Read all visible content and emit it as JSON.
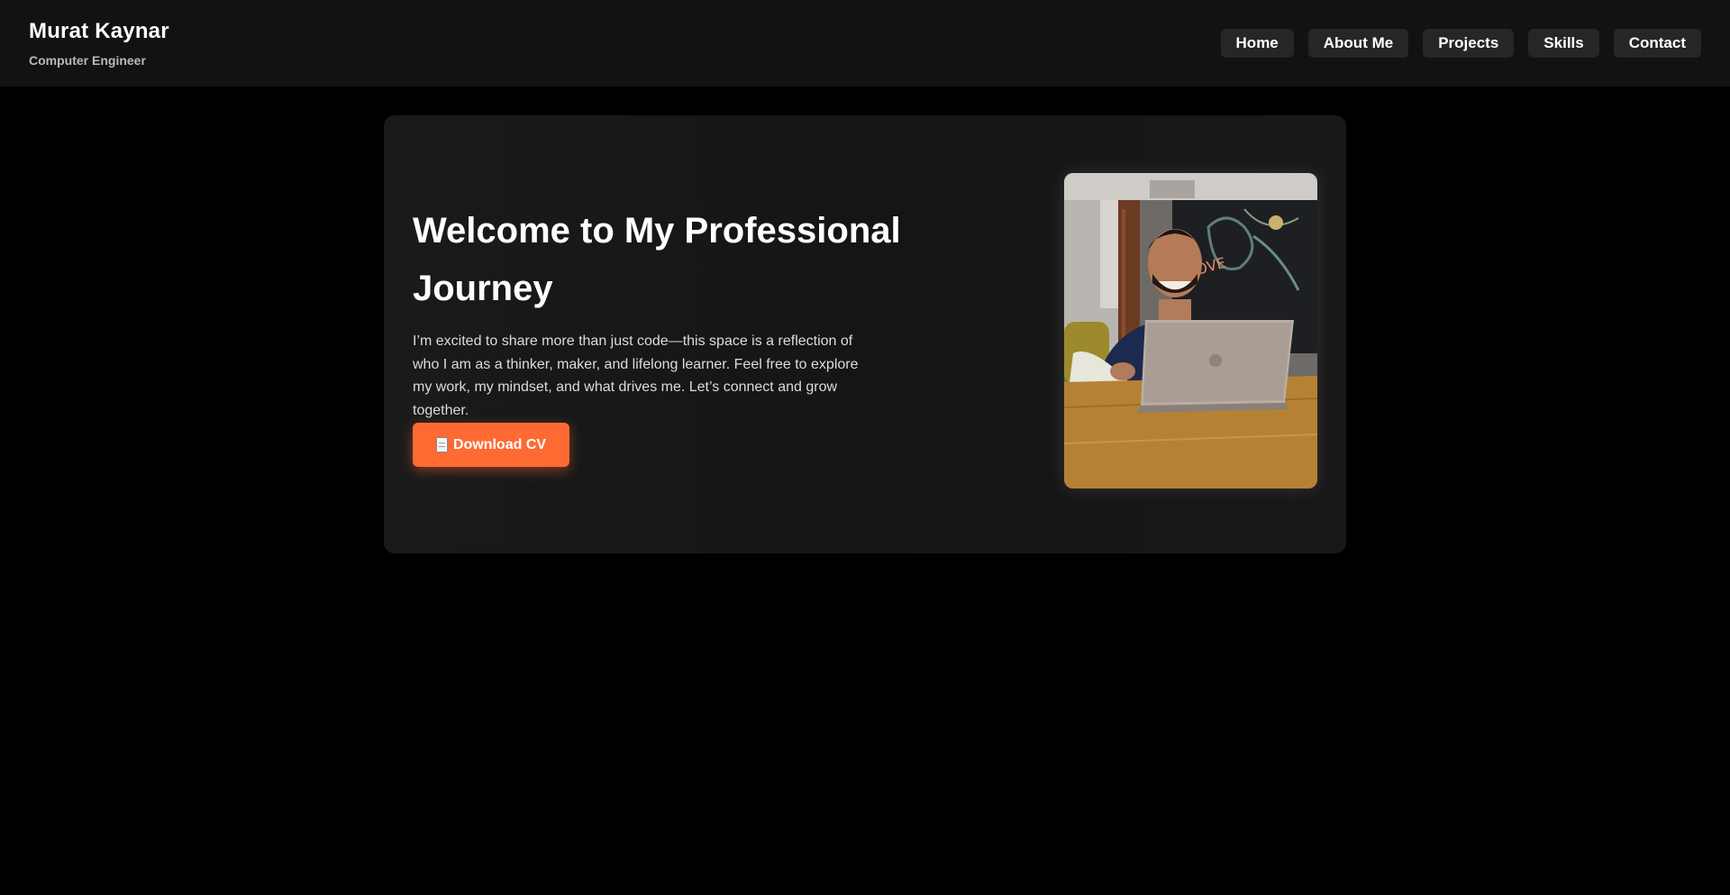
{
  "header": {
    "name": "Murat Kaynar",
    "role": "Computer Engineer",
    "nav": [
      "Home",
      "About Me",
      "Projects",
      "Skills",
      "Contact"
    ]
  },
  "hero": {
    "title": "Welcome to My Professional Journey",
    "text": "I’m excited to share more than just code—this space is a reflection of who I am as a thinker, maker, and lifelong learner. Feel free to explore my work, my mindset, and what drives me. Let’s connect and grow together.",
    "cv_button": "Download CV",
    "cv_icon": "document-icon"
  },
  "colors": {
    "page_bg": "#000000",
    "header_bg": "#121212",
    "card_bg": "#1a1a1a",
    "nav_button_bg": "#262626",
    "accent": "#ff6a33"
  }
}
